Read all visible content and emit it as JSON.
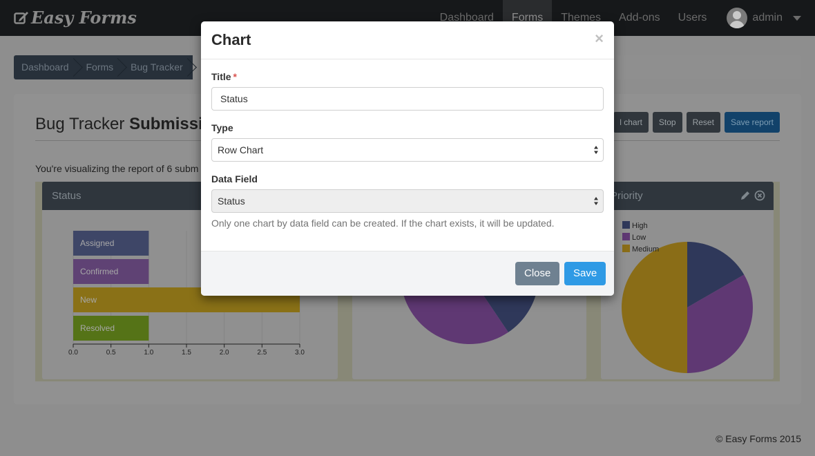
{
  "navbar": {
    "brand": "Easy Forms",
    "items": [
      {
        "label": "Dashboard",
        "active": false
      },
      {
        "label": "Forms",
        "active": true
      },
      {
        "label": "Themes",
        "active": false
      },
      {
        "label": "Add-ons",
        "active": false
      },
      {
        "label": "Users",
        "active": false
      }
    ],
    "user": "admin"
  },
  "breadcrumb": [
    "Dashboard",
    "Forms",
    "Bug Tracker"
  ],
  "page": {
    "title_plain": "Bug Tracker ",
    "title_bold": "Submissi",
    "visualizing_text": "You're visualizing the report of 6 subm",
    "toolbar": {
      "add_chart": "l chart",
      "stop": "Stop",
      "reset": "Reset",
      "save_report": "Save report"
    }
  },
  "cards": {
    "status": {
      "title": "Status"
    },
    "priority": {
      "title": "Priority"
    }
  },
  "chart_data": [
    {
      "type": "bar",
      "orientation": "horizontal",
      "title": "Status",
      "categories": [
        "Assigned",
        "Confirmed",
        "New",
        "Resolved"
      ],
      "values": [
        1,
        1,
        3,
        1
      ],
      "colors": [
        "#4e5e9f",
        "#8f55b9",
        "#e6b400",
        "#7cb800"
      ],
      "x_ticks": [
        "0.0",
        "0.5",
        "1.0",
        "1.5",
        "2.0",
        "2.5",
        "3.0"
      ],
      "xlim": [
        0,
        3
      ],
      "grid": true
    },
    {
      "type": "pie",
      "title": "Priority",
      "categories": [
        "High",
        "Low",
        "Medium"
      ],
      "values": [
        1,
        2,
        3
      ],
      "colors": [
        "#2f4186",
        "#8f42b8",
        "#e6ac00"
      ],
      "legend": "top-left"
    }
  ],
  "modal": {
    "title": "Chart",
    "close_glyph": "×",
    "title_label": "Title",
    "required_mark": "*",
    "title_value": "Status",
    "type_label": "Type",
    "type_value": "Row Chart",
    "data_field_label": "Data Field",
    "data_field_value": "Status",
    "help_text": "Only one chart by data field can be created. If the chart exists, it will be updated.",
    "close_button": "Close",
    "save_button": "Save"
  },
  "footer": "© Easy Forms 2015",
  "colors": {
    "primary": "#2f9ae5",
    "secondary": "#6f8191",
    "required": "#d9534f"
  }
}
